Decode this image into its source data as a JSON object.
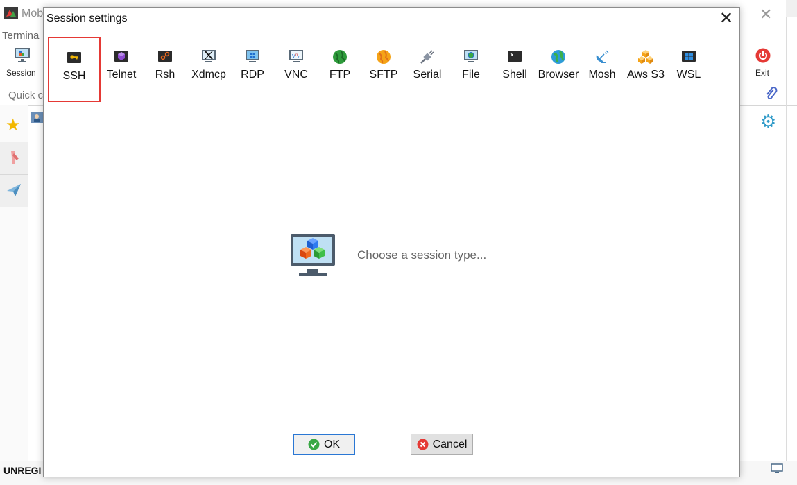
{
  "background_window": {
    "title": "Mob",
    "menu_label": "Termina",
    "session_label": "Session",
    "exit_label": "Exit",
    "quick_label": "Quick c",
    "status_text": "UNREGI"
  },
  "dialog": {
    "title": "Session settings",
    "session_types": [
      {
        "label": "SSH",
        "icon": "key-icon",
        "selected": true
      },
      {
        "label": "Telnet",
        "icon": "telnet-icon"
      },
      {
        "label": "Rsh",
        "icon": "rsh-icon"
      },
      {
        "label": "Xdmcp",
        "icon": "xdmcp-icon"
      },
      {
        "label": "RDP",
        "icon": "rdp-icon"
      },
      {
        "label": "VNC",
        "icon": "vnc-icon"
      },
      {
        "label": "FTP",
        "icon": "ftp-globe-icon"
      },
      {
        "label": "SFTP",
        "icon": "sftp-globe-icon"
      },
      {
        "label": "Serial",
        "icon": "serial-plug-icon"
      },
      {
        "label": "File",
        "icon": "file-monitor-icon"
      },
      {
        "label": "Shell",
        "icon": "shell-terminal-icon"
      },
      {
        "label": "Browser",
        "icon": "browser-globe-icon"
      },
      {
        "label": "Mosh",
        "icon": "mosh-satellite-icon"
      },
      {
        "label": "Aws S3",
        "icon": "aws-cubes-icon"
      },
      {
        "label": "WSL",
        "icon": "wsl-windows-icon"
      }
    ],
    "prompt": "Choose a session type...",
    "ok_label": "OK",
    "cancel_label": "Cancel"
  }
}
